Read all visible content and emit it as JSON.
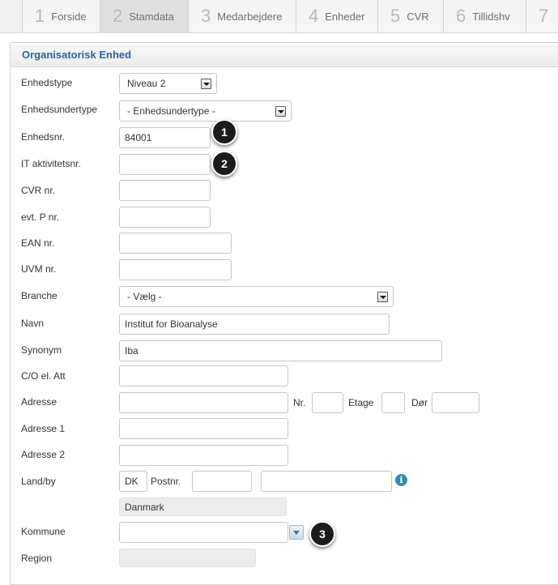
{
  "tabs": [
    {
      "num": "1",
      "label": "Forside"
    },
    {
      "num": "2",
      "label": "Stamdata"
    },
    {
      "num": "3",
      "label": "Medarbejdere"
    },
    {
      "num": "4",
      "label": "Enheder"
    },
    {
      "num": "5",
      "label": "CVR"
    },
    {
      "num": "6",
      "label": "Tillidshv"
    },
    {
      "num": "7",
      "label": ""
    }
  ],
  "active_tab": "Stamdata",
  "panel": {
    "title": "Organisatorisk Enhed"
  },
  "form": {
    "enhedstype": {
      "label": "Enhedstype",
      "value": "Niveau 2"
    },
    "enhedsundertype": {
      "label": "Enhedsundertype",
      "value": "- Enhedsundertype -"
    },
    "enhedsnr": {
      "label": "Enhedsnr.",
      "value": "84001"
    },
    "it_aktivitetsnr": {
      "label": "IT aktivitetsnr.",
      "value": ""
    },
    "cvr_nr": {
      "label": "CVR nr.",
      "value": ""
    },
    "p_nr": {
      "label": "evt. P nr.",
      "value": ""
    },
    "ean_nr": {
      "label": "EAN nr.",
      "value": ""
    },
    "uvm_nr": {
      "label": "UVM nr.",
      "value": ""
    },
    "branche": {
      "label": "Branche",
      "value": "- Vælg -"
    },
    "navn": {
      "label": "Navn",
      "value": "Institut for Bioanalyse"
    },
    "synonym": {
      "label": "Synonym",
      "value": "Iba"
    },
    "co_att": {
      "label": "C/O el. Att",
      "value": ""
    },
    "adresse": {
      "label": "Adresse",
      "value": "",
      "nr_label": "Nr.",
      "nr_value": "",
      "etage_label": "Etage",
      "etage_value": "",
      "dor_label": "Dør",
      "dor_value": ""
    },
    "adresse1": {
      "label": "Adresse 1",
      "value": ""
    },
    "adresse2": {
      "label": "Adresse 2",
      "value": ""
    },
    "land_by": {
      "label": "Land/by",
      "country": "DK",
      "postnr_label": "Postnr.",
      "postnr_value": "",
      "city_value": "",
      "country_name": "Danmark"
    },
    "kommune": {
      "label": "Kommune",
      "value": ""
    },
    "region": {
      "label": "Region",
      "value": ""
    }
  },
  "callouts": [
    "1",
    "2",
    "3"
  ],
  "colors": {
    "panel_title": "#2a6496",
    "info_icon": "#3a87ad",
    "badge": "#1b1b1b"
  },
  "icons": {
    "info": "info-icon",
    "dropdown": "chevron-down-icon"
  }
}
